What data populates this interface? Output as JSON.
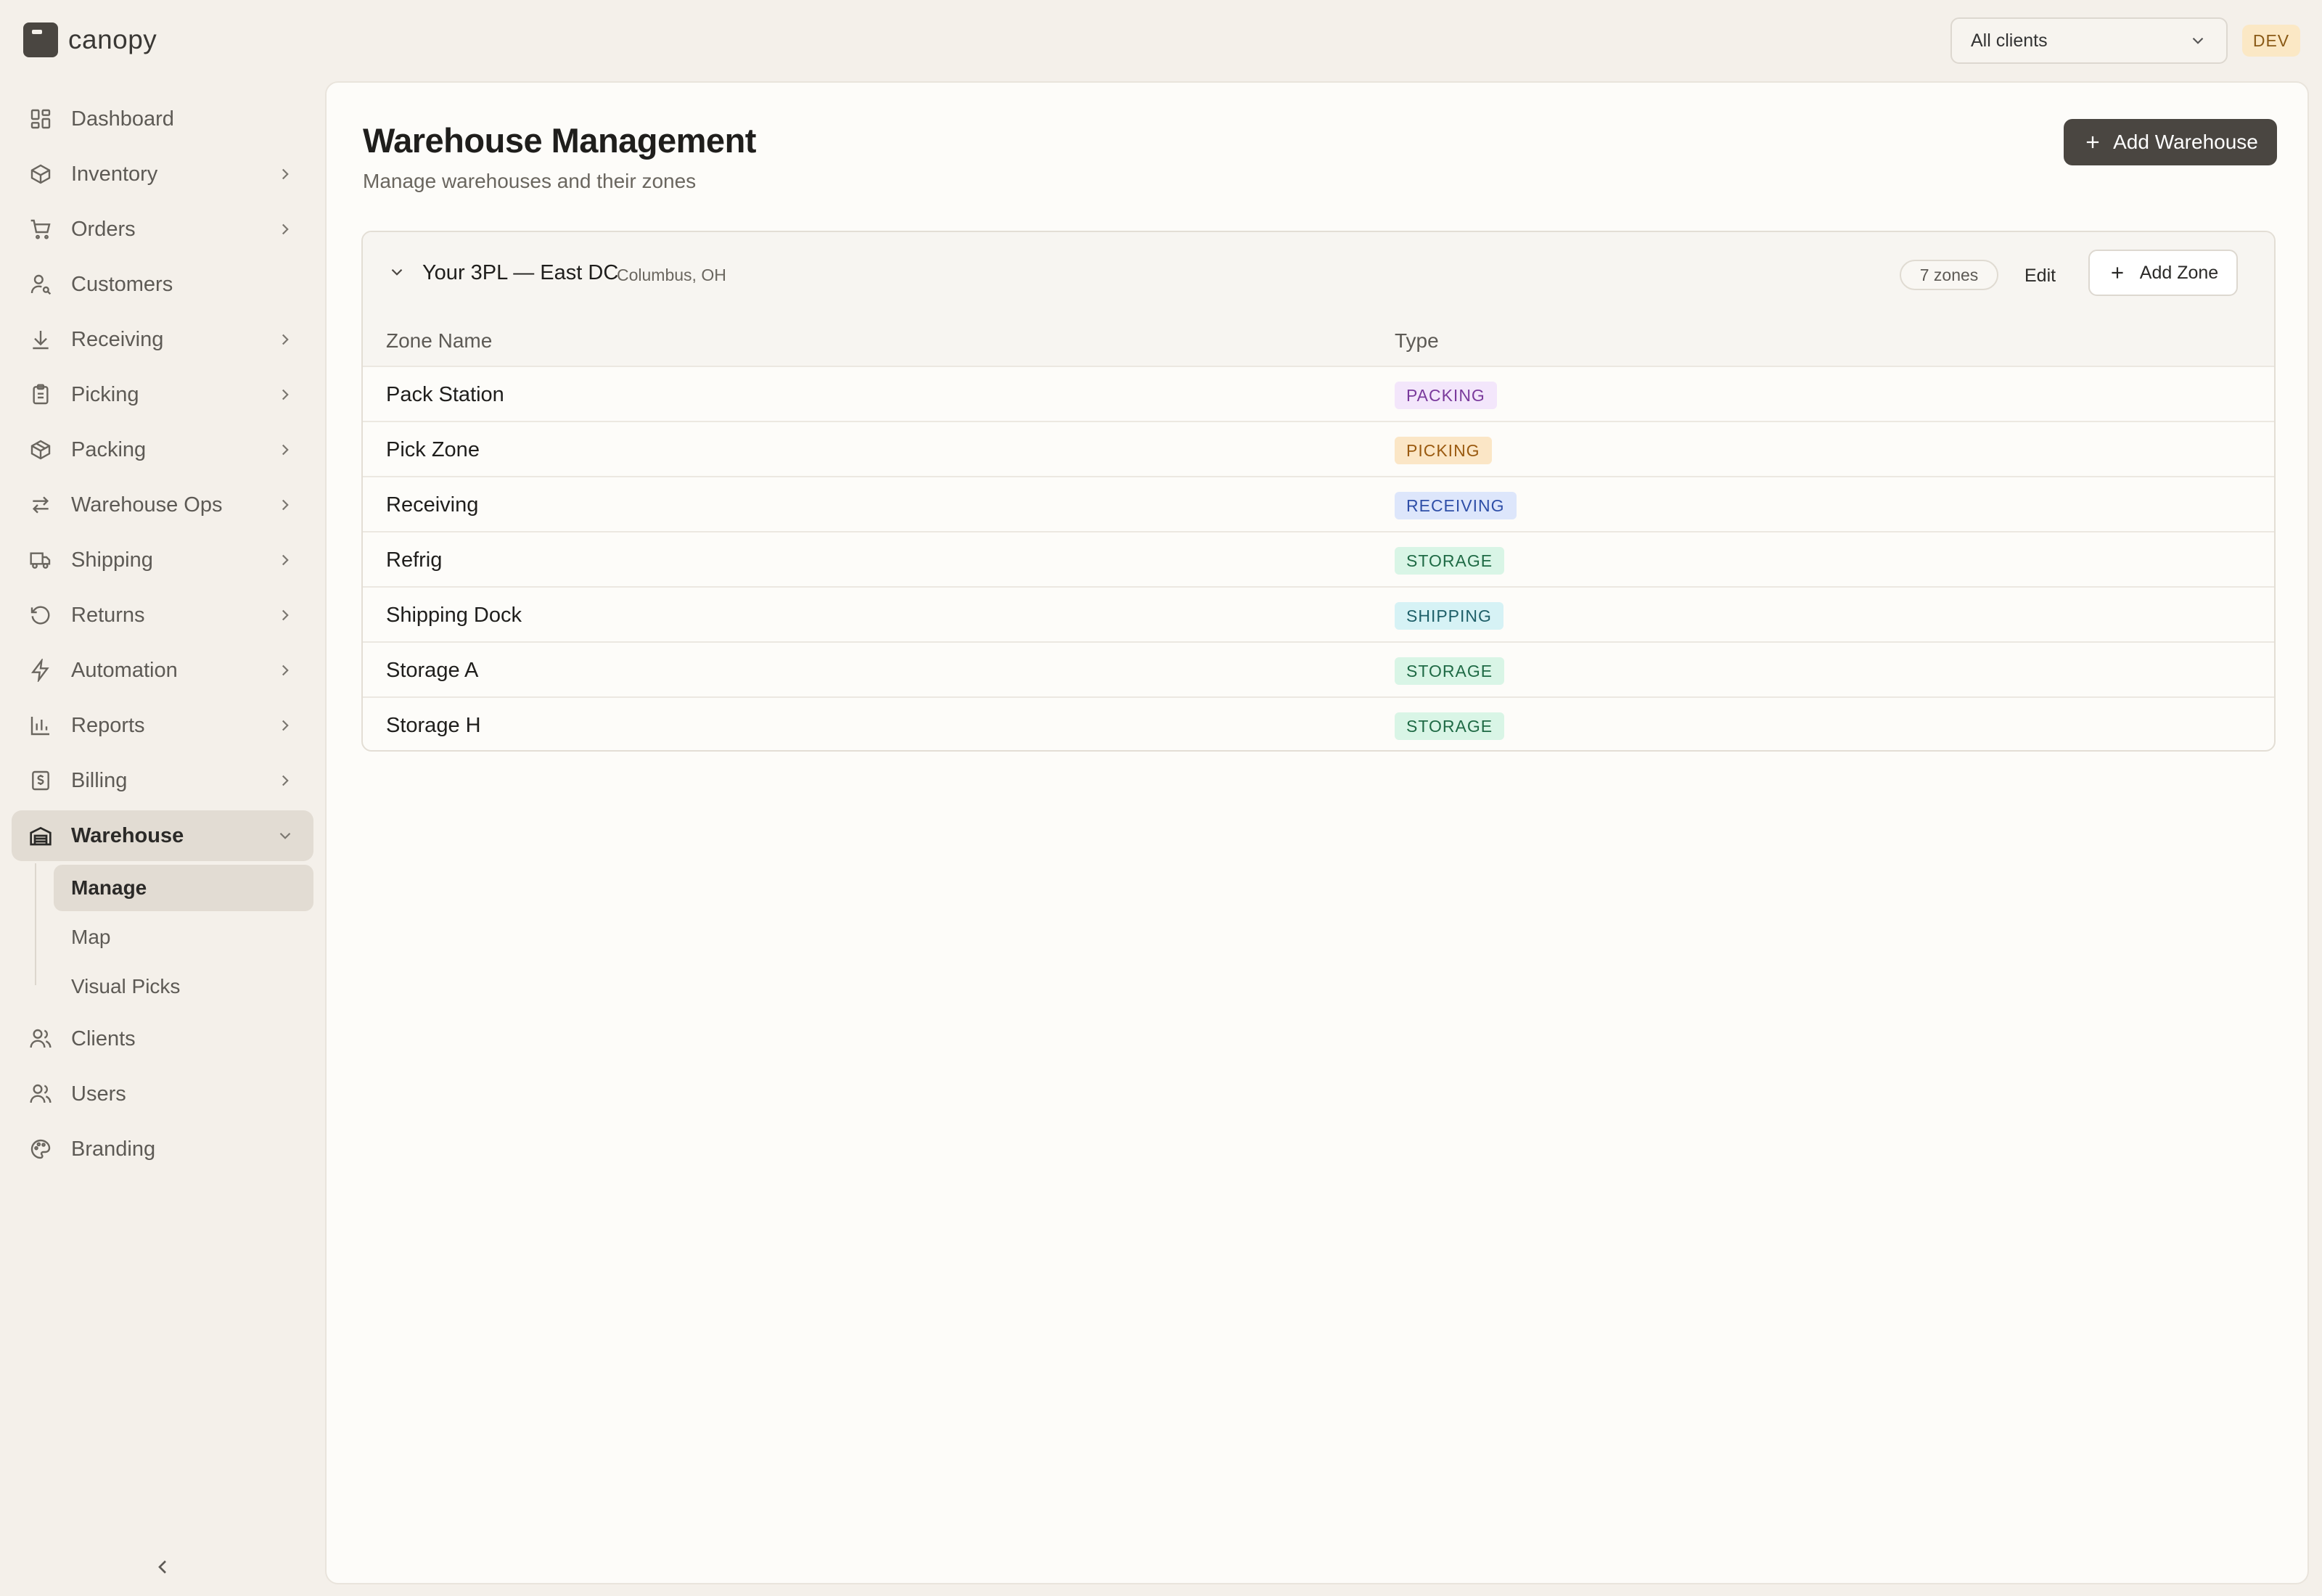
{
  "app": {
    "name": "canopy",
    "env_badge": "DEV"
  },
  "client_select": {
    "value": "All clients"
  },
  "sidebar": {
    "items": [
      {
        "label": "Dashboard",
        "icon": "dashboard-icon",
        "expandable": false
      },
      {
        "label": "Inventory",
        "icon": "box-icon",
        "expandable": true
      },
      {
        "label": "Orders",
        "icon": "cart-icon",
        "expandable": true
      },
      {
        "label": "Customers",
        "icon": "user-search-icon",
        "expandable": false
      },
      {
        "label": "Receiving",
        "icon": "download-icon",
        "expandable": true
      },
      {
        "label": "Picking",
        "icon": "clipboard-icon",
        "expandable": true
      },
      {
        "label": "Packing",
        "icon": "package-icon",
        "expandable": true
      },
      {
        "label": "Warehouse Ops",
        "icon": "arrows-exchange-icon",
        "expandable": true
      },
      {
        "label": "Shipping",
        "icon": "truck-icon",
        "expandable": true
      },
      {
        "label": "Returns",
        "icon": "rotate-ccw-icon",
        "expandable": true
      },
      {
        "label": "Automation",
        "icon": "zap-icon",
        "expandable": true
      },
      {
        "label": "Reports",
        "icon": "bar-chart-icon",
        "expandable": true
      },
      {
        "label": "Billing",
        "icon": "receipt-icon",
        "expandable": true
      },
      {
        "label": "Warehouse",
        "icon": "warehouse-icon",
        "expandable": true,
        "active": true
      }
    ],
    "warehouse_sub": [
      "Manage",
      "Map",
      "Visual Picks"
    ],
    "bottom_items": [
      {
        "label": "Clients",
        "icon": "users-icon"
      },
      {
        "label": "Users",
        "icon": "users-icon"
      },
      {
        "label": "Branding",
        "icon": "palette-icon"
      }
    ]
  },
  "page": {
    "title": "Warehouse Management",
    "subtitle": "Manage warehouses and their zones",
    "add_warehouse_label": "Add Warehouse"
  },
  "warehouse": {
    "name": "Your 3PL — East DC",
    "location": "Columbus, OH",
    "zones_count": "7 zones",
    "edit_label": "Edit",
    "add_zone_label": "Add Zone",
    "columns": [
      "Zone Name",
      "Type"
    ],
    "zones": [
      {
        "name": "Pack Station",
        "type": "PACKING"
      },
      {
        "name": "Pick Zone",
        "type": "PICKING"
      },
      {
        "name": "Receiving",
        "type": "RECEIVING"
      },
      {
        "name": "Refrig",
        "type": "STORAGE"
      },
      {
        "name": "Shipping Dock",
        "type": "SHIPPING"
      },
      {
        "name": "Storage A",
        "type": "STORAGE"
      },
      {
        "name": "Storage H",
        "type": "STORAGE"
      }
    ]
  },
  "colors": {
    "accent_button": "#4a4641",
    "PACKING": {
      "bg": "#f3e6fb",
      "fg": "#7a3a9c"
    },
    "PICKING": {
      "bg": "#fbe6c6",
      "fg": "#9a5a10"
    },
    "RECEIVING": {
      "bg": "#dde6fb",
      "fg": "#2f4fa8"
    },
    "STORAGE": {
      "bg": "#d9f5e6",
      "fg": "#1f6a45"
    },
    "SHIPPING": {
      "bg": "#d6f2f5",
      "fg": "#1e5f68"
    }
  }
}
